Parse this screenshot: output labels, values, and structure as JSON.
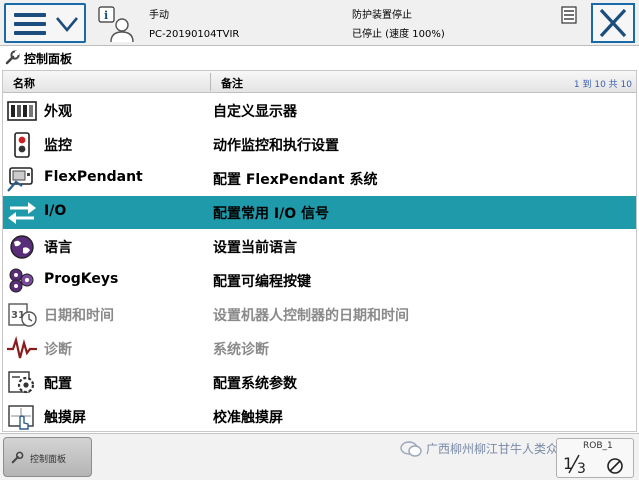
{
  "topbar": {
    "mode": "手动",
    "controller": "PC-20190104TVIR",
    "safety": "防护装置停止",
    "state": "已停止 (速度 100%)"
  },
  "panel": {
    "title": "控制面板"
  },
  "table": {
    "col_name": "名称",
    "col_desc": "备注",
    "pager": "1 到 10 共 10",
    "rows": [
      {
        "name": "外观",
        "desc": "自定义显示器",
        "icon": "appearance-icon"
      },
      {
        "name": "监控",
        "desc": "动作监控和执行设置",
        "icon": "supervision-icon"
      },
      {
        "name": "FlexPendant",
        "desc": "配置 FlexPendant 系统",
        "icon": "flexpendant-icon"
      },
      {
        "name": "I/O",
        "desc": "配置常用 I/O 信号",
        "icon": "io-icon",
        "selected": true
      },
      {
        "name": "语言",
        "desc": "设置当前语言",
        "icon": "language-icon"
      },
      {
        "name": "ProgKeys",
        "desc": "配置可编程按键",
        "icon": "progkeys-icon"
      },
      {
        "name": "日期和时间",
        "desc": "设置机器人控制器的日期和时间",
        "icon": "date-time-icon",
        "dim": true
      },
      {
        "name": "诊断",
        "desc": "系统诊断",
        "icon": "diagnostics-icon",
        "dim": true
      },
      {
        "name": "配置",
        "desc": "配置系统参数",
        "icon": "configuration-icon"
      },
      {
        "name": "触摸屏",
        "desc": "校准触摸屏",
        "icon": "touchscreen-icon"
      }
    ]
  },
  "bottombar": {
    "task_label": "控制面板",
    "watermark": "广西柳州柳江甘牛人类众号",
    "quickset_label": "ROB_1"
  },
  "colors": {
    "selected_row": "#1e9aaa",
    "button_border": "#1a6aa8"
  }
}
